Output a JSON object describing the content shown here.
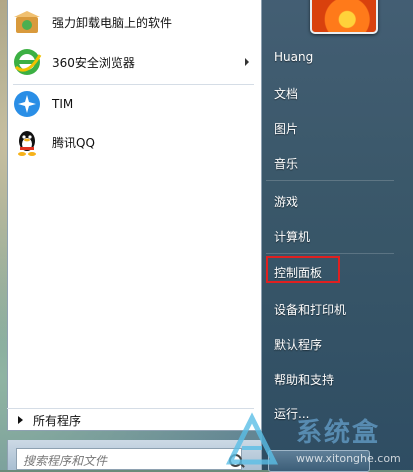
{
  "left_programs": [
    {
      "label": "强力卸载电脑上的软件",
      "icon": "uninstall-box-icon",
      "has_submenu": false
    },
    {
      "label": "360安全浏览器",
      "icon": "360-browser-icon",
      "has_submenu": true
    },
    {
      "label": "TIM",
      "icon": "tim-icon",
      "has_submenu": false
    },
    {
      "label": "腾讯QQ",
      "icon": "qq-penguin-icon",
      "has_submenu": false
    }
  ],
  "all_programs_label": "所有程序",
  "search": {
    "placeholder": "搜索程序和文件"
  },
  "right_items": [
    {
      "label": "Huang"
    },
    {
      "label": "文档"
    },
    {
      "label": "图片"
    },
    {
      "label": "音乐"
    },
    {
      "label": "游戏"
    },
    {
      "label": "计算机"
    },
    {
      "label": "控制面板",
      "highlighted": true
    },
    {
      "label": "设备和打印机"
    },
    {
      "label": "默认程序"
    },
    {
      "label": "帮助和支持"
    },
    {
      "label": "运行..."
    }
  ],
  "watermark": {
    "text": "系统盒",
    "url": "www.xitonghe.com"
  },
  "colors": {
    "highlight_border": "#e02020",
    "right_panel": "#3e5b73"
  }
}
